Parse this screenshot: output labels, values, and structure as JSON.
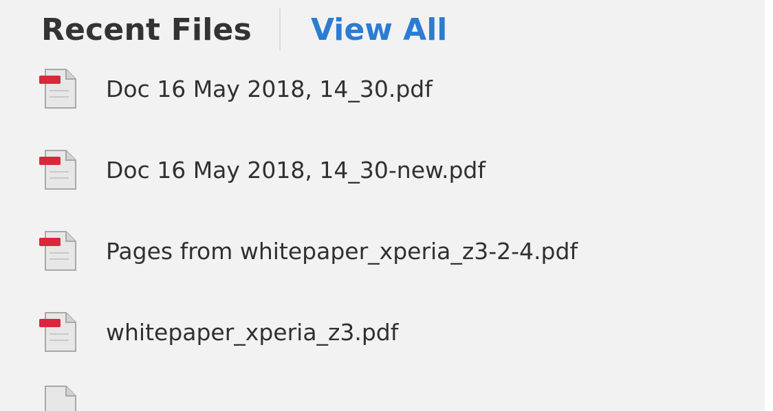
{
  "header": {
    "title": "Recent Files",
    "view_all_label": "View All"
  },
  "files": [
    {
      "name": "Doc 16 May 2018, 14_30.pdf",
      "icon": "pdf-file-icon"
    },
    {
      "name": "Doc 16 May 2018, 14_30-new.pdf",
      "icon": "pdf-file-icon"
    },
    {
      "name": "Pages from whitepaper_xperia_z3-2-4.pdf",
      "icon": "pdf-file-icon"
    },
    {
      "name": "whitepaper_xperia_z3.pdf",
      "icon": "pdf-file-icon"
    }
  ],
  "colors": {
    "background": "#f2f2f2",
    "title_text": "#333333",
    "link": "#2b7cd3",
    "file_text": "#303030",
    "pdf_tab": "#d9283a"
  }
}
